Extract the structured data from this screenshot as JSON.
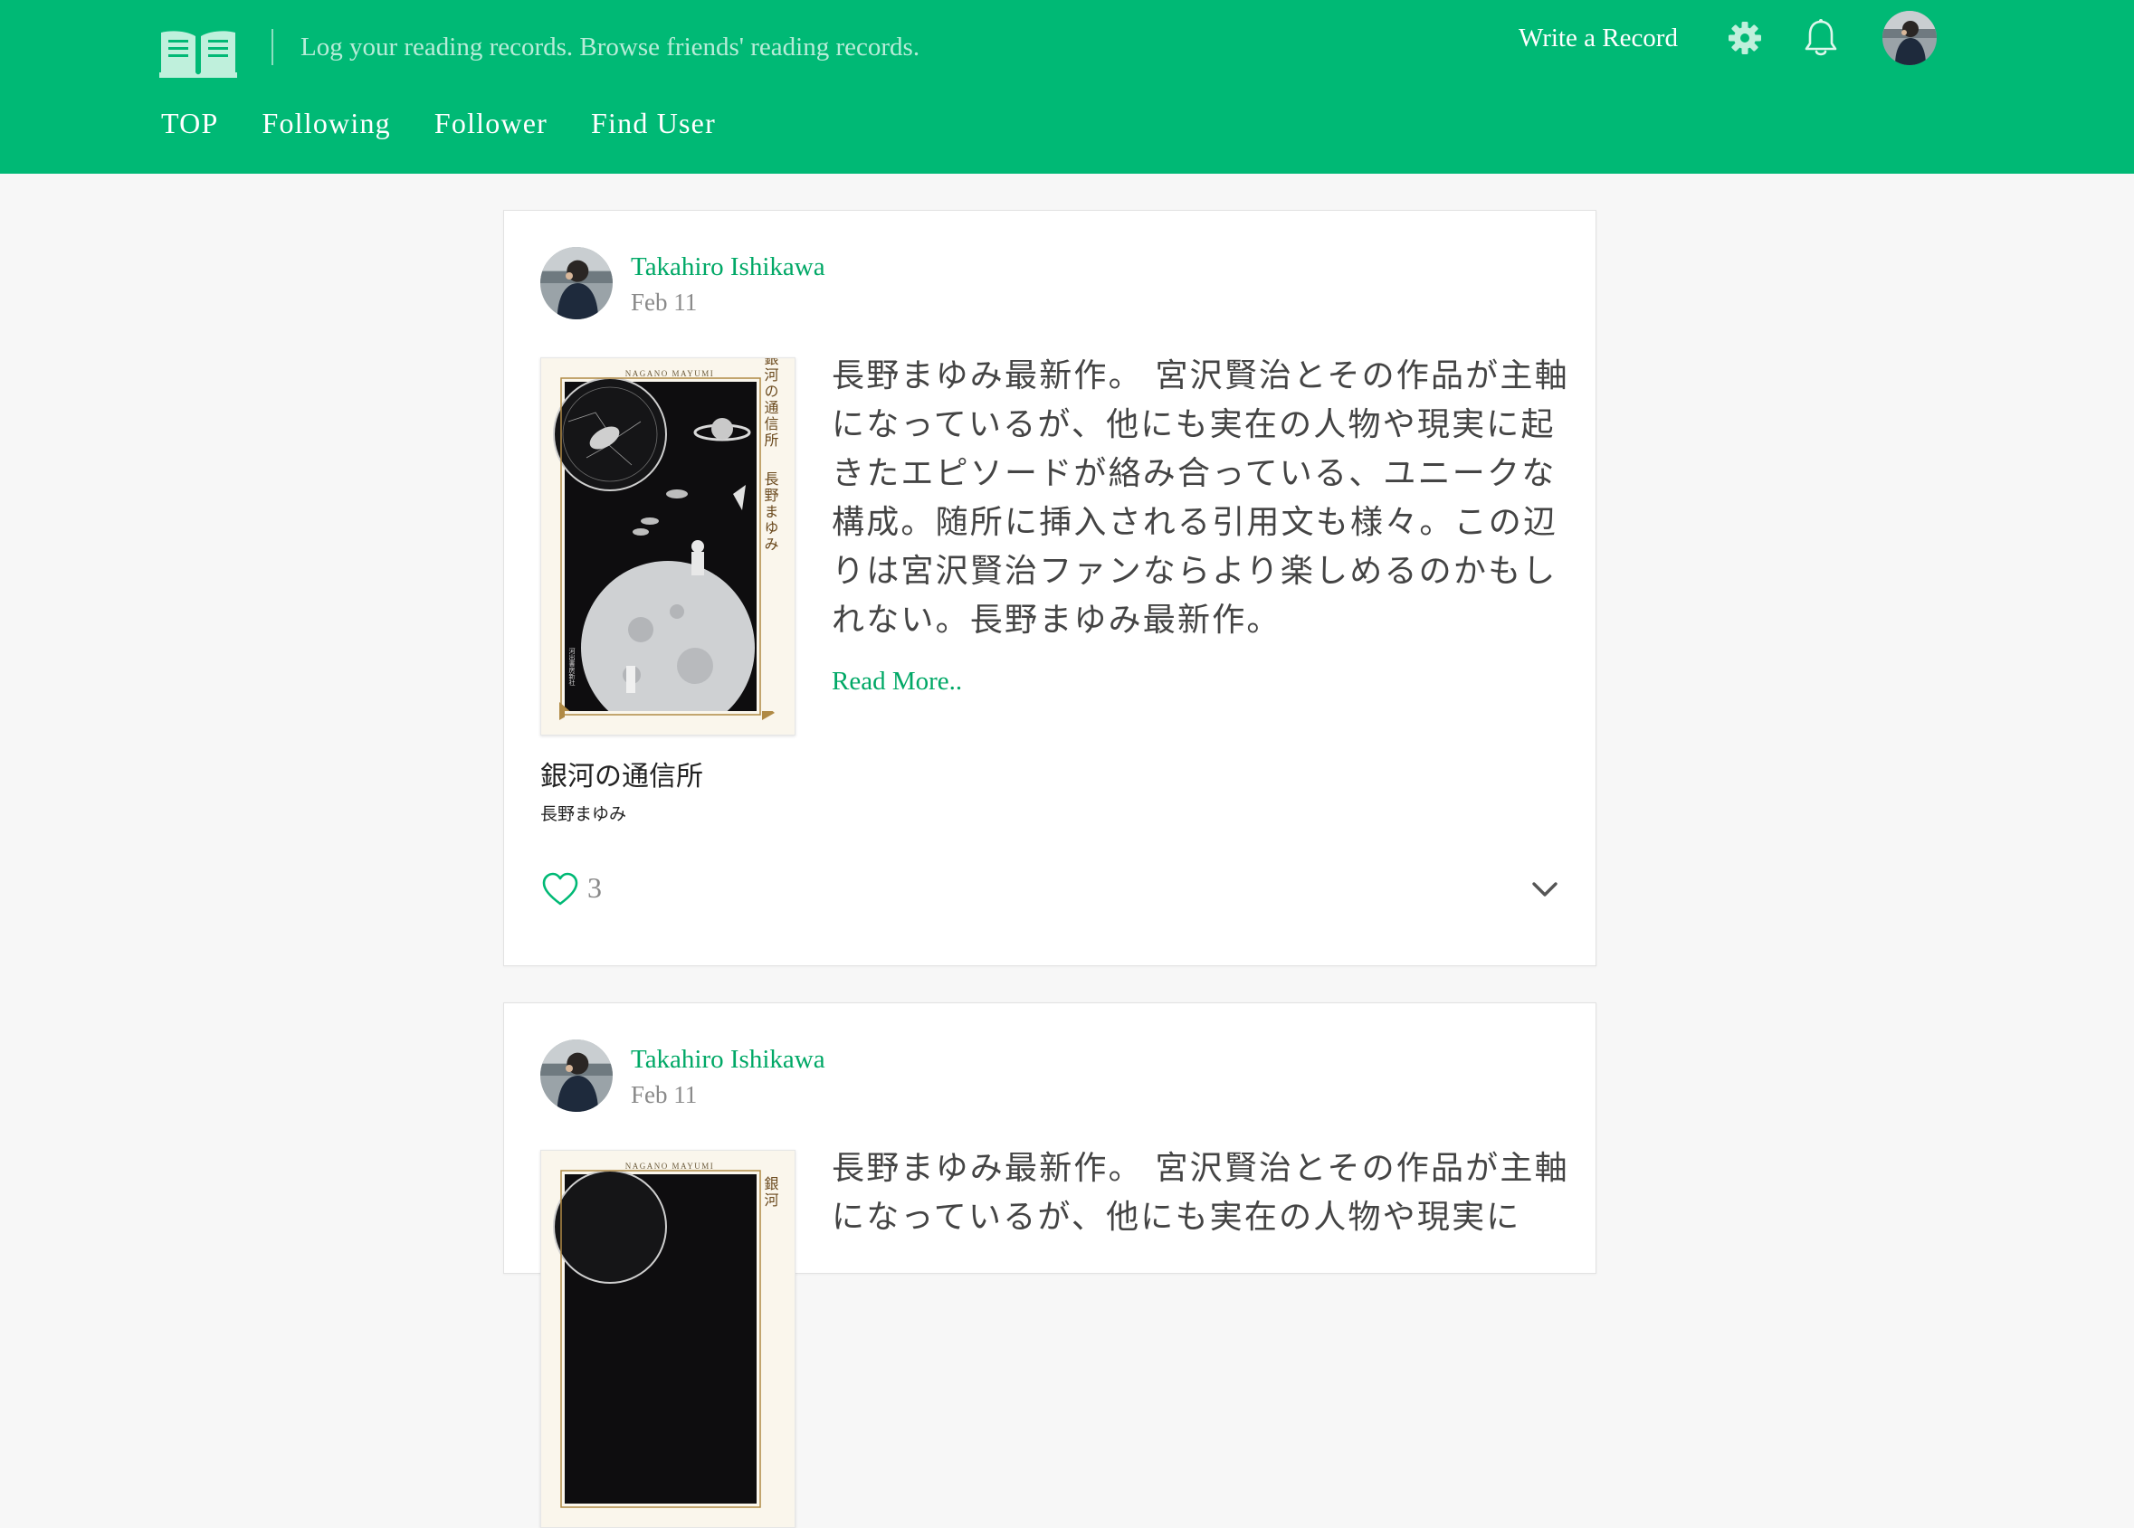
{
  "header": {
    "logo_icon": "open-book-icon",
    "tagline": "Log your reading records. Browse friends' reading records.",
    "nav": [
      {
        "label": "TOP"
      },
      {
        "label": "Following"
      },
      {
        "label": "Follower"
      },
      {
        "label": "Find User"
      }
    ],
    "write_record_label": "Write a Record",
    "settings_icon": "gear-icon",
    "notifications_icon": "bell-icon",
    "profile_icon": "avatar"
  },
  "theme": {
    "brand": "#00b975",
    "link": "#00a866",
    "background": "#f7f7f7"
  },
  "posts": [
    {
      "user_name": "Takahiro Ishikawa",
      "date": "Feb 11",
      "book": {
        "title": "銀河の通信所",
        "author": "長野まゆみ",
        "cover_author_latin": "NAGANO MAYUMI",
        "cover_title_vertical": "銀河の通信所",
        "cover_author_vertical": "長野まゆみ",
        "cover_publisher": "河出書房新社"
      },
      "review": "長野まゆみ最新作。 宮沢賢治とその作品が主軸になっているが、他にも実在の人物や現実に起きたエピソードが絡み合っている、ユニークな構成。随所に挿入される引用文も様々。この辺りは宮沢賢治ファンならより楽しめるのかもしれない。長野まゆみ最新作。",
      "read_more_label": "Read More..",
      "likes": "3"
    },
    {
      "user_name": "Takahiro Ishikawa",
      "date": "Feb 11",
      "book": {
        "cover_author_latin": "NAGANO MAYUMI",
        "cover_title_vertical": "銀河"
      },
      "review": "長野まゆみ最新作。 宮沢賢治とその作品が主軸になっているが、他にも実在の人物や現実に"
    }
  ]
}
